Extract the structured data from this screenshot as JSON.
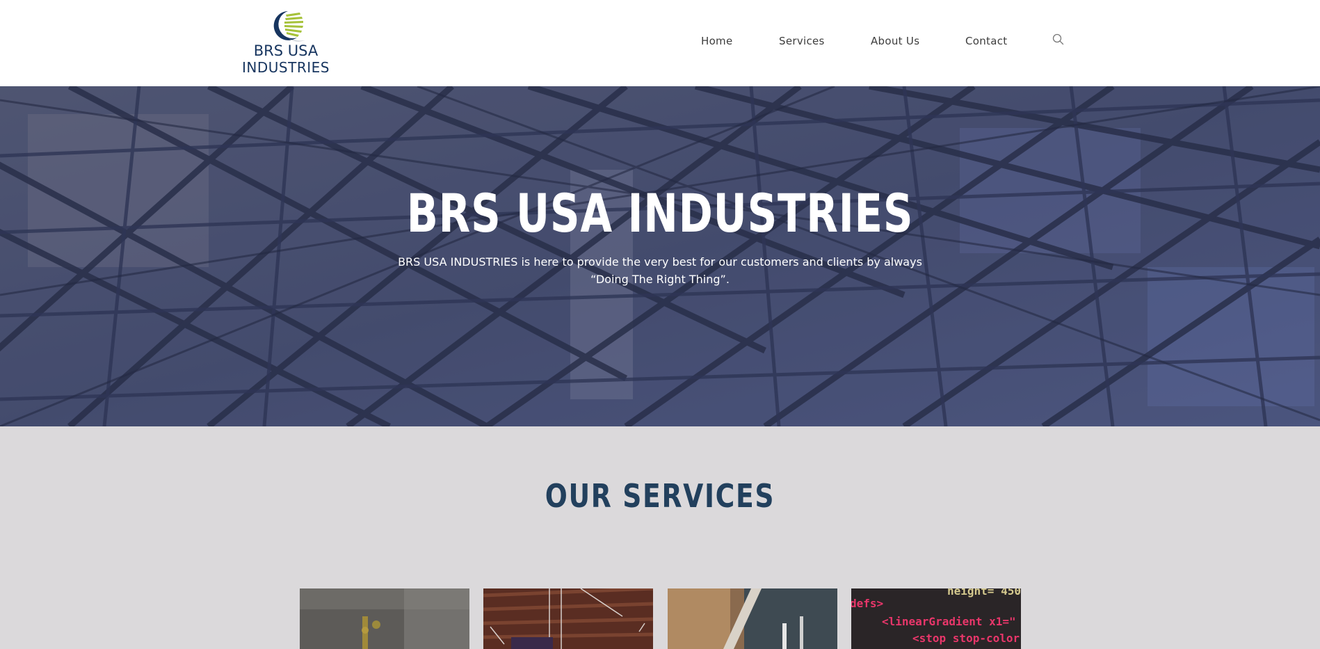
{
  "header": {
    "logo": {
      "line1": "BRS USA",
      "line2": "INDUSTRIES",
      "icon": "crescent-sun-logo-icon"
    },
    "nav": [
      {
        "label": "Home"
      },
      {
        "label": "Services"
      },
      {
        "label": "About Us"
      },
      {
        "label": "Contact"
      }
    ],
    "search_icon": "search-icon"
  },
  "hero": {
    "title": "BRS USA INDUSTRIES",
    "text": "BRS USA INDUSTRIES is here to provide the very best for our customers and clients by always “Doing The Right Thing”."
  },
  "services": {
    "title": "OUR SERVICES",
    "card4_code": {
      "line1": "height= 450",
      "line2": "defs>",
      "line3": "<linearGradient x1=\"",
      "line4": "<stop stop-color"
    }
  },
  "colors": {
    "brand_navy": "#17355f",
    "brand_green": "#a6c23a",
    "services_heading": "#22405d",
    "services_bg": "#dbd9db",
    "nav_text": "#3d3d3d"
  }
}
